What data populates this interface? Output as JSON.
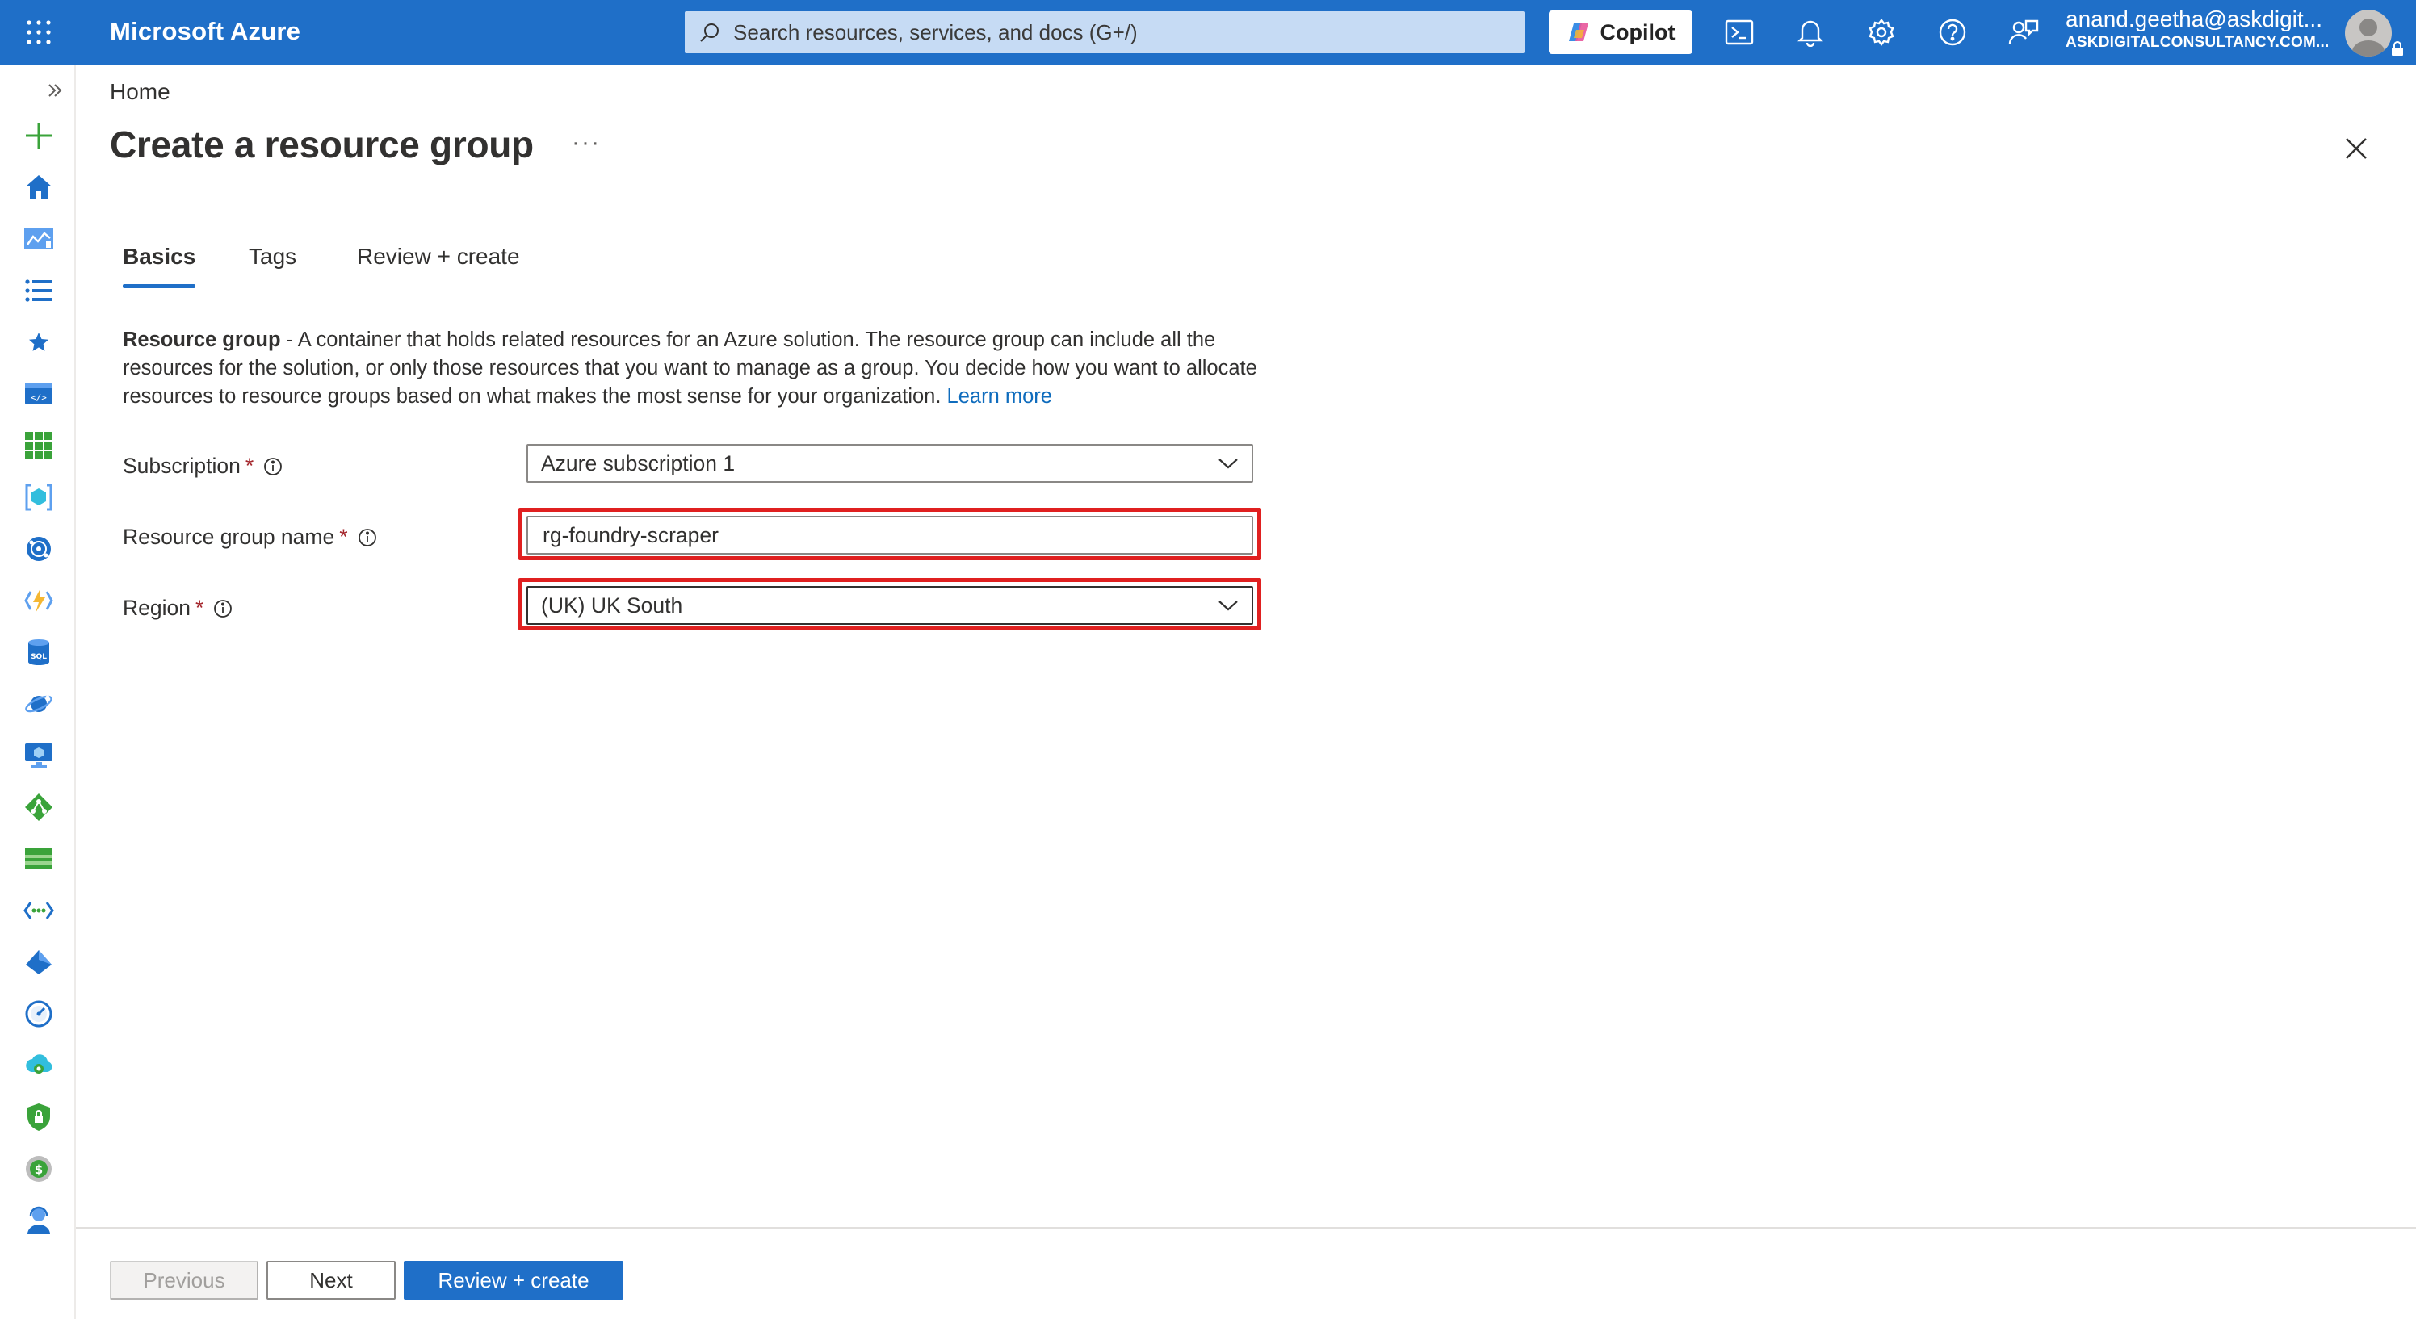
{
  "app": {
    "brand": "Microsoft Azure",
    "search_placeholder": "Search resources, services, and docs (G+/)",
    "copilot_label": "Copilot",
    "account_email": "anand.geetha@askdigit...",
    "account_tenant": "ASKDIGITALCONSULTANCY.COM...",
    "accent_color": "#1f6fc8"
  },
  "topbar_icons": [
    "cloud-shell-icon",
    "notifications-bell-icon",
    "settings-gear-icon",
    "help-question-icon",
    "feedback-icon"
  ],
  "rail_icons": [
    "expand-chevrons-icon",
    "create-resource-plus-icon",
    "home-icon",
    "dashboard-icon",
    "all-services-list-icon",
    "favorites-star-icon",
    "app-services-icon",
    "all-resources-grid-icon",
    "resource-groups-icon",
    "cosmos-db-icon",
    "function-app-icon",
    "sql-database-icon",
    "azure-cosmos-orbit-icon",
    "virtual-machines-icon",
    "load-balancer-icon",
    "storage-accounts-icon",
    "virtual-networks-icon",
    "microsoft-entra-id-icon",
    "monitor-icon",
    "advisor-icon",
    "defender-shield-icon",
    "cost-management-icon",
    "help-support-icon"
  ],
  "breadcrumb": "Home",
  "page_title": "Create a resource group",
  "more_label": "···",
  "tabs": [
    {
      "label": "Basics",
      "active": true
    },
    {
      "label": "Tags",
      "active": false
    },
    {
      "label": "Review + create",
      "active": false
    }
  ],
  "description": {
    "bold": "Resource group",
    "text": " - A container that holds related resources for an Azure solution. The resource group can include all the resources for the solution, or only those resources that you want to manage as a group. You decide how you want to allocate resources to resource groups based on what makes the most sense for your organization.",
    "link": "Learn more"
  },
  "form": {
    "subscription": {
      "label": "Subscription",
      "required": "*",
      "value": "Azure subscription 1"
    },
    "resource_group_name": {
      "label": "Resource group name",
      "required": "*",
      "value": "rg-foundry-scraper"
    },
    "region": {
      "label": "Region",
      "required": "*",
      "value": "(UK) UK South"
    }
  },
  "footer": {
    "previous": "Previous",
    "next": "Next",
    "review_create": "Review + create"
  }
}
